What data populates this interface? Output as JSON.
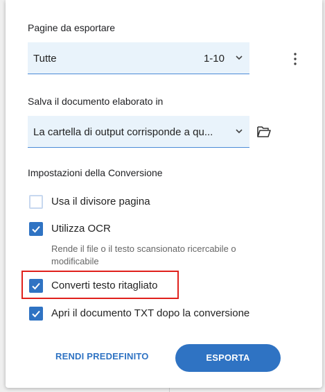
{
  "pages": {
    "label": "Pagine da esportare",
    "selected": "Tutte",
    "range": "1-10"
  },
  "save": {
    "label": "Salva il documento elaborato in",
    "selected": "La cartella di output corrisponde a qu..."
  },
  "conversion": {
    "label": "Impostazioni della Conversione",
    "options": [
      {
        "label": "Usa il divisore pagina",
        "checked": false
      },
      {
        "label": "Utilizza OCR",
        "checked": true,
        "hint": "Rende il file o il testo scansionato ricercabile o modificabile"
      },
      {
        "label": "Converti testo ritagliato",
        "checked": true
      },
      {
        "label": "Apri il documento TXT dopo la conversione",
        "checked": true
      }
    ]
  },
  "buttons": {
    "default_label": "RENDI PREDEFINITO",
    "export_label": "ESPORTA"
  },
  "colors": {
    "accent": "#2f73c3",
    "field_bg": "#e9f3fb",
    "highlight": "#e0201b"
  },
  "icons": [
    "more-vert-icon",
    "chevron-down-icon",
    "folder-open-icon",
    "check-icon"
  ]
}
